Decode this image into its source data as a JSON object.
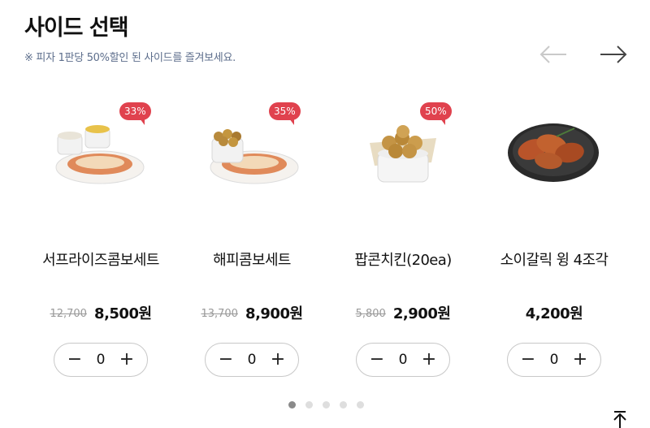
{
  "header": {
    "title": "사이드 선택",
    "subtitle": "※ 피자 1판당 50%할인 된 사이드를 즐겨보세요."
  },
  "nav": {
    "prev_icon": "arrow-left-icon",
    "next_icon": "arrow-right-icon"
  },
  "products": [
    {
      "name": "서프라이즈콤보세트",
      "discount": "33%",
      "original_price": "12,700",
      "sale_price": "8,500원",
      "quantity": "0",
      "image": "combo-set-image"
    },
    {
      "name": "해피콤보세트",
      "discount": "35%",
      "original_price": "13,700",
      "sale_price": "8,900원",
      "quantity": "0",
      "image": "happy-combo-image"
    },
    {
      "name": "팝콘치킨(20ea)",
      "discount": "50%",
      "original_price": "5,800",
      "sale_price": "2,900원",
      "quantity": "0",
      "image": "popcorn-chicken-image"
    },
    {
      "name": "소이갈릭 윙 4조각",
      "discount": "",
      "original_price": "",
      "sale_price": "4,200원",
      "quantity": "0",
      "image": "soy-garlic-wing-image"
    }
  ],
  "stepper": {
    "minus": "−",
    "plus": "+"
  },
  "pagination": {
    "count": 5,
    "active": 1
  },
  "colors": {
    "badge": "#e0424e",
    "subtitle": "#5d6e8c",
    "dot_active": "#8a8a8a",
    "dot_inactive": "#dedede"
  }
}
